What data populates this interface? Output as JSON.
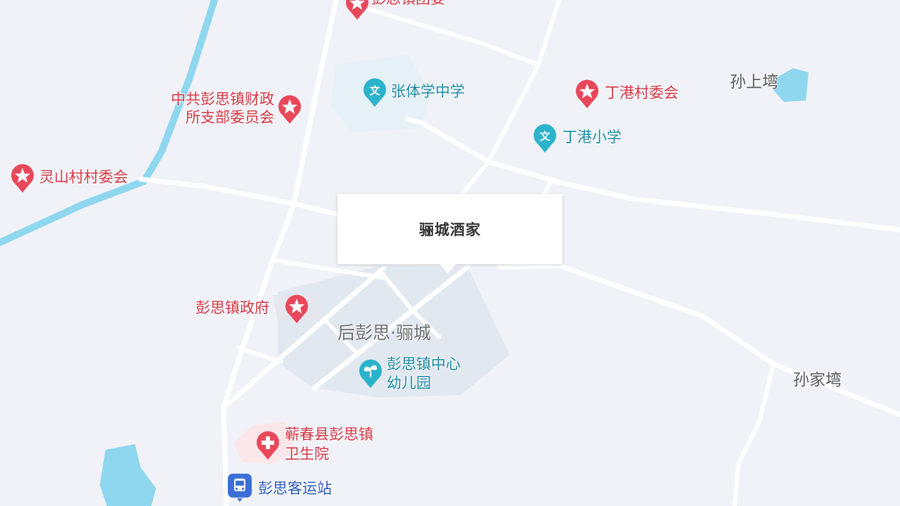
{
  "map": {
    "colors": {
      "background": "#f0f2f7",
      "road": "#ffffff",
      "water": "#8fd6ef",
      "poi_red": "#e8485a",
      "poi_teal": "#2bb3cc",
      "poi_blue": "#3b6fd6"
    },
    "popup": {
      "label": "骊城酒家"
    },
    "areas": {
      "town_name": "后彭思·骊城"
    },
    "places": {
      "sun_shang_wan": "孙上塆",
      "sun_jia_wan": "孙家塆"
    },
    "pois": {
      "top_cut": "彭思镇团委",
      "cpc_finance_line1": "中共彭思镇财政",
      "cpc_finance_line2": "所支部委员会",
      "lingshan": "灵山村村委会",
      "zhangtixue": "张体学中学",
      "dinggang_committee": "丁港村委会",
      "dinggang_school": "丁港小学",
      "gov": "彭思镇政府",
      "kindergarten_line1": "彭思镇中心",
      "kindergarten_line2": "幼儿园",
      "hospital_line1": "蕲春县彭思镇",
      "hospital_line2": "卫生院",
      "bus_station": "彭思客运站"
    },
    "icons": {
      "gov": "star-pin-icon",
      "school": "school-pin-icon",
      "kindergarten": "sprout-pin-icon",
      "hospital": "cross-pin-icon",
      "bus": "bus-icon"
    }
  }
}
